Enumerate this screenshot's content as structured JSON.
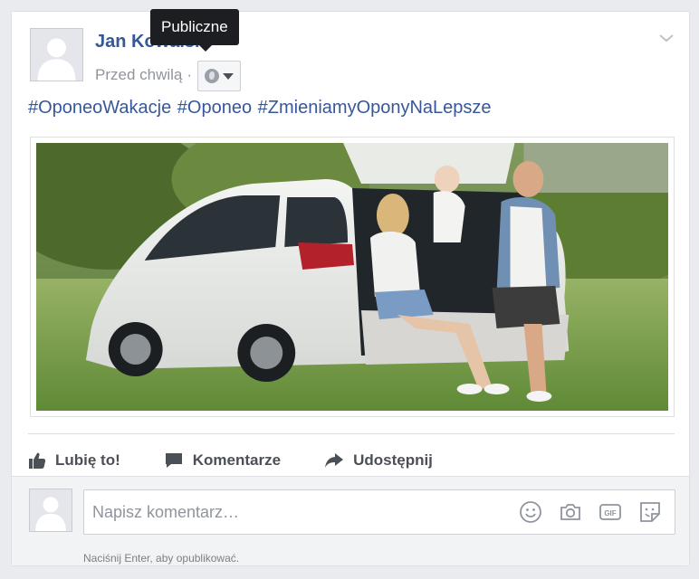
{
  "post": {
    "author": "Jan Kowalski",
    "timestamp": "Przed chwilą",
    "separator": "·",
    "audience_tooltip": "Publiczne",
    "hashtags": "#OponeoWakacje #Oponeo #ZmieniamyOponyNaLepsze",
    "icons": {
      "audience": "globe-icon",
      "options": "chevron-down-icon"
    }
  },
  "actions": [
    {
      "label": "Lubię to!",
      "icon": "thumbs-up-icon"
    },
    {
      "label": "Komentarze",
      "icon": "speech-bubble-icon"
    },
    {
      "label": "Udostępnij",
      "icon": "share-arrow-icon"
    }
  ],
  "comment": {
    "placeholder": "Napisz komentarz…",
    "hint": "Naciśnij Enter, aby opublikować.",
    "icons": [
      "emoji-icon",
      "camera-icon",
      "gif-icon",
      "sticker-icon"
    ]
  },
  "colors": {
    "link": "#365899",
    "secondary_text": "#90949c",
    "action_text": "#4b4f56",
    "card_bg": "#ffffff",
    "page_bg": "#e9ebee"
  }
}
